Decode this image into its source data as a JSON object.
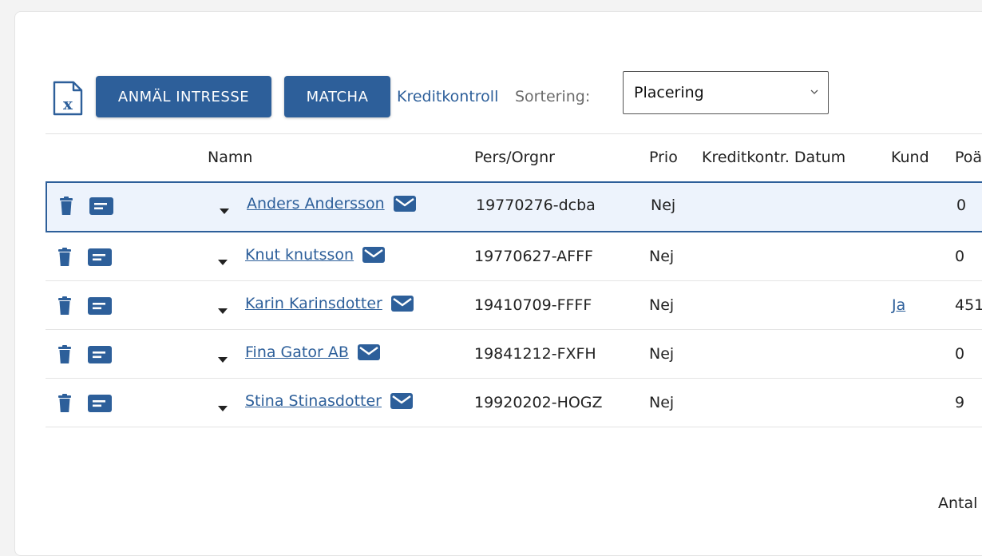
{
  "toolbar": {
    "excel_icon": "excel-export-icon",
    "anmal_label": "ANMÄL INTRESSE",
    "matcha_label": "MATCHA",
    "kreditkontroll_label": "Kreditkontroll",
    "sortering_label": "Sortering:",
    "sort_select_value": "Placering"
  },
  "colors": {
    "accent": "#2d5f9a",
    "selected_row_bg": "#edf3fc"
  },
  "table": {
    "headers": [
      "Namn",
      "Pers/Orgnr",
      "Prio",
      "Kreditkontr. Datum",
      "Kund",
      "Poä"
    ],
    "rows": [
      {
        "name": "Anders Andersson",
        "orgnr": "19770276-dcba",
        "prio": "Nej",
        "kredit_datum": "",
        "kund": "",
        "poang": "0",
        "selected": true
      },
      {
        "name": "Knut knutsson",
        "orgnr": "19770627-AFFF",
        "prio": "Nej",
        "kredit_datum": "",
        "kund": "",
        "poang": "0",
        "selected": false
      },
      {
        "name": "Karin Karinsdotter",
        "orgnr": "19410709-FFFF",
        "prio": "Nej",
        "kredit_datum": "",
        "kund": "Ja",
        "poang": "451",
        "selected": false
      },
      {
        "name": "Fina Gator AB",
        "orgnr": "19841212-FXFH",
        "prio": "Nej",
        "kredit_datum": "",
        "kund": "",
        "poang": "0",
        "selected": false
      },
      {
        "name": "Stina Stinasdotter",
        "orgnr": "19920202-HOGZ",
        "prio": "Nej",
        "kredit_datum": "",
        "kund": "",
        "poang": "9",
        "selected": false
      }
    ]
  },
  "footer": {
    "antal_label": "Antal"
  }
}
